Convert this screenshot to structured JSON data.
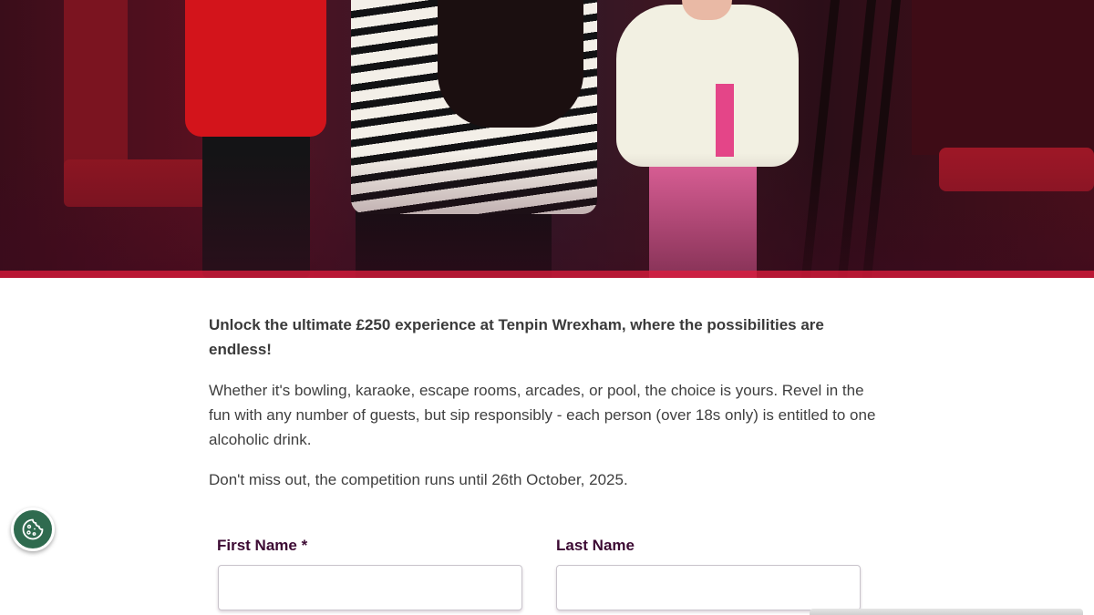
{
  "hero": {
    "image": "family-bowling-photo"
  },
  "intro": {
    "lead": "Unlock the ultimate £250 experience at Tenpin Wrexham, where the possibilities are endless!",
    "body": "Whether it's bowling, karaoke, escape rooms, arcades, or pool, the choice is yours. Revel in the fun with any number of guests, but sip responsibly - each person (over 18s only) is entitled to one alcoholic drink.",
    "deadline": "Don't miss out, the competition runs until 26th October, 2025."
  },
  "form": {
    "first_name_label": "First Name",
    "first_name_required": "*",
    "first_name_value": "",
    "last_name_label": "Last Name",
    "last_name_value": ""
  },
  "cookie": {
    "icon": "cookie-icon",
    "color": "#2f6b4f"
  },
  "colors": {
    "label": "#3c0a33",
    "text": "#3f3f3f"
  }
}
